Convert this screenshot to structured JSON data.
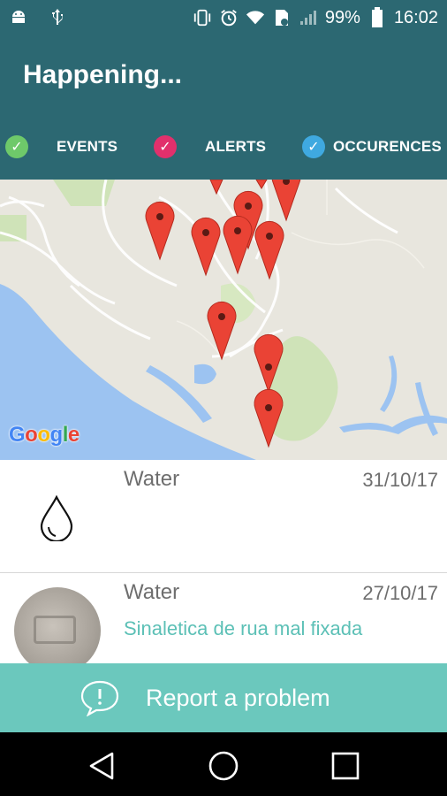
{
  "status": {
    "battery": "99%",
    "time": "16:02"
  },
  "header": {
    "title": "Happening..."
  },
  "filters": [
    {
      "label": "EVENTS",
      "color": "#6ec96a",
      "checked": true
    },
    {
      "label": "ALERTS",
      "color": "#e1306c",
      "checked": true
    },
    {
      "label": "OCCURENCES",
      "color": "#3fa9e0",
      "checked": true
    }
  ],
  "map": {
    "attribution": "Google"
  },
  "list": [
    {
      "category": "Water",
      "date": "31/10/17",
      "description": ""
    },
    {
      "category": "Water",
      "date": "27/10/17",
      "description": "Sinaletica de rua mal fixada"
    }
  ],
  "report": {
    "label": "Report a problem",
    "color": "#6bc8bd"
  },
  "navbar": {
    "back": "back-icon",
    "home": "home-icon",
    "recents": "recents-icon"
  }
}
